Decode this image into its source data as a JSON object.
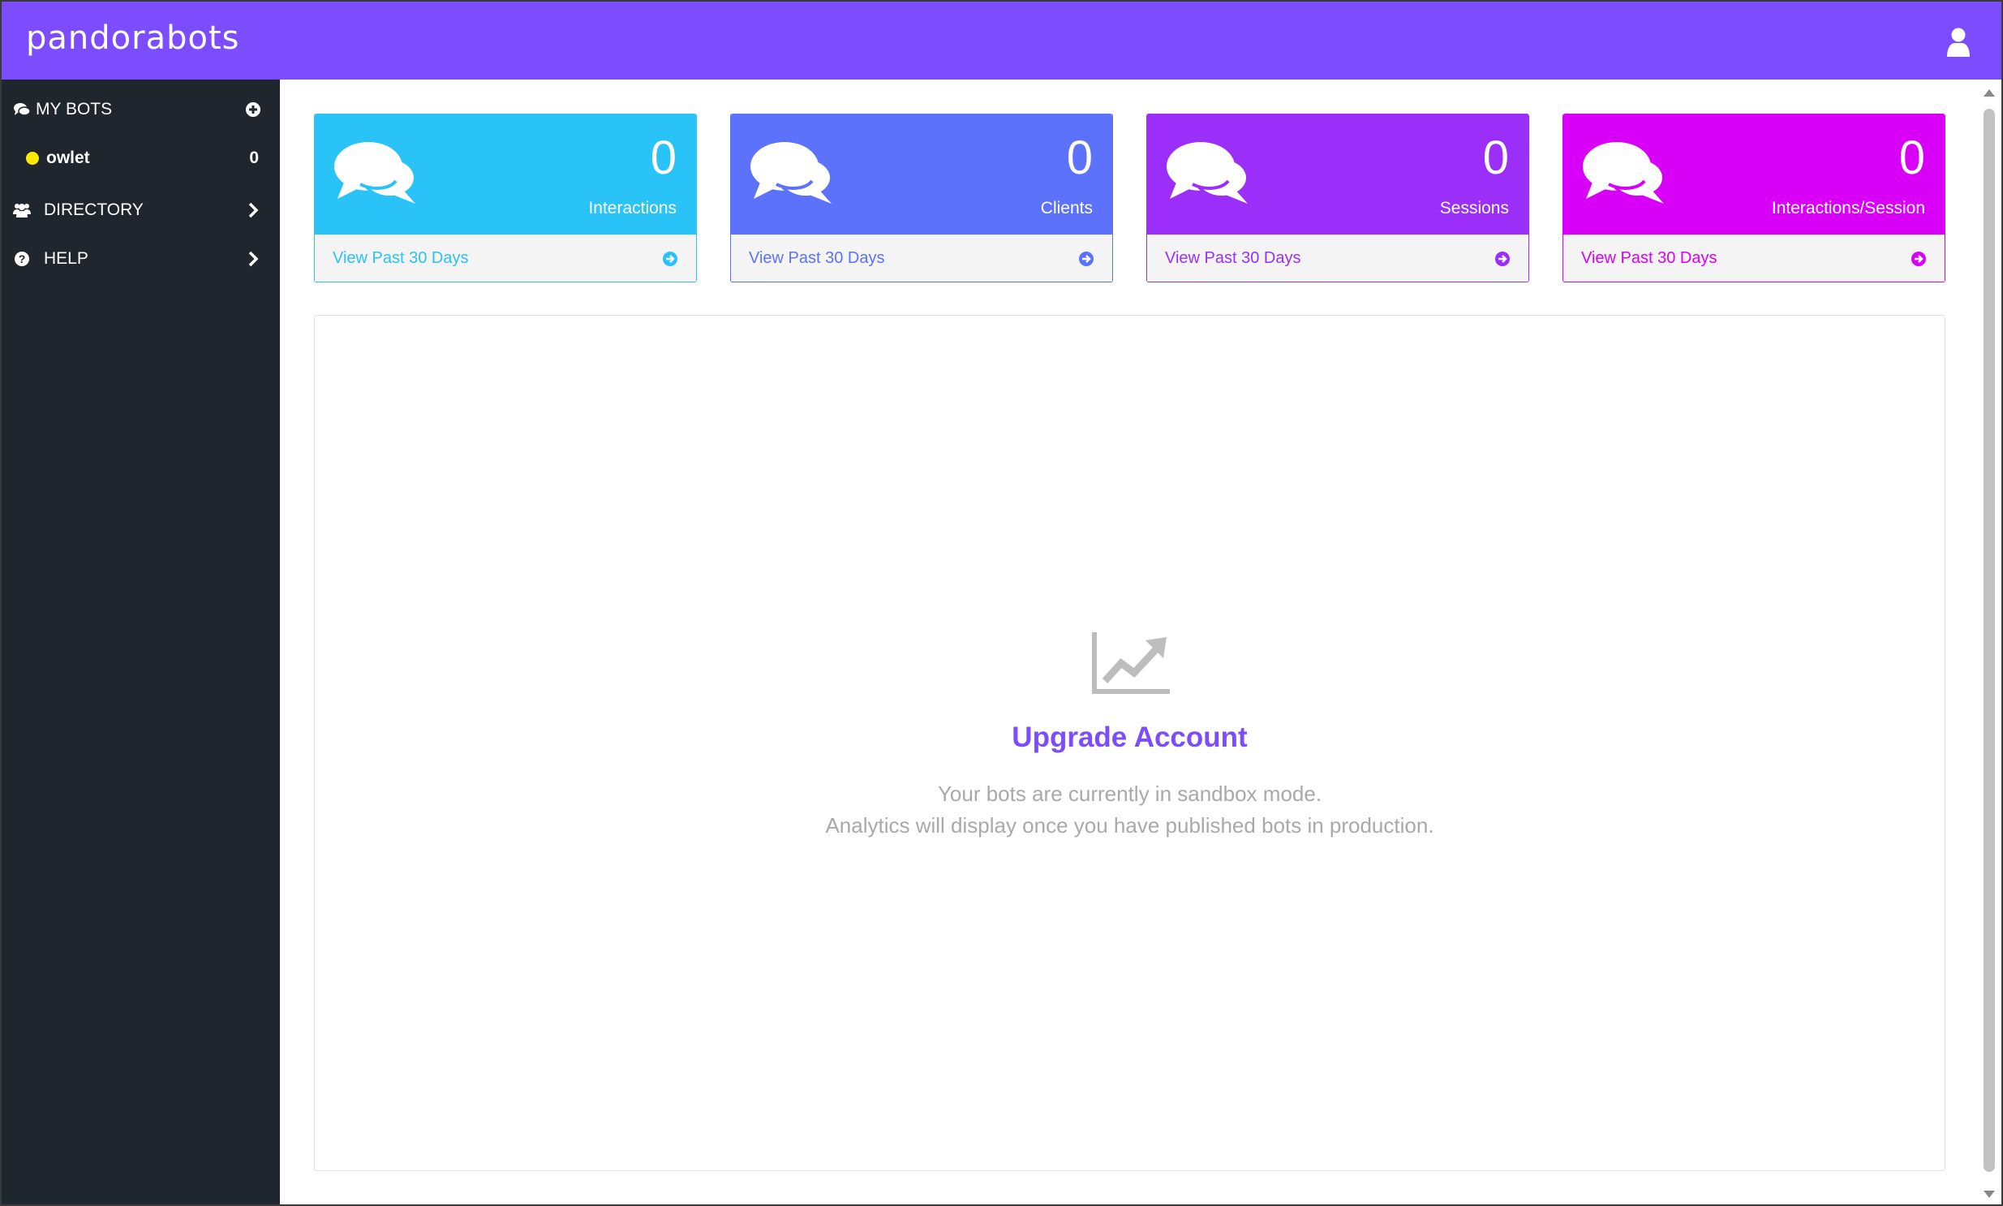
{
  "header": {
    "brand": "pandorabots",
    "user_icon": "user-icon",
    "color": "#7b4dff"
  },
  "sidebar": {
    "my_bots_label": "MY BOTS",
    "bots": [
      {
        "name": "owlet",
        "count": "0",
        "status_color": "#ffea00"
      }
    ],
    "directory_label": "DIRECTORY",
    "help_label": "HELP"
  },
  "stats": [
    {
      "value": "0",
      "caption": "Interactions",
      "link": "View Past 30 Days",
      "color": "#29c3f8"
    },
    {
      "value": "0",
      "caption": "Clients",
      "link": "View Past 30 Days",
      "color": "#5c72fb"
    },
    {
      "value": "0",
      "caption": "Sessions",
      "link": "View Past 30 Days",
      "color": "#9b2ff9"
    },
    {
      "value": "0",
      "caption": "Interactions/Session",
      "link": "View Past 30 Days",
      "color": "#d900f7"
    }
  ],
  "panel": {
    "icon": "line-chart-icon",
    "title": "Upgrade Account",
    "line1": "Your bots are currently in sandbox mode.",
    "line2": "Analytics will display once you have published bots in production."
  }
}
